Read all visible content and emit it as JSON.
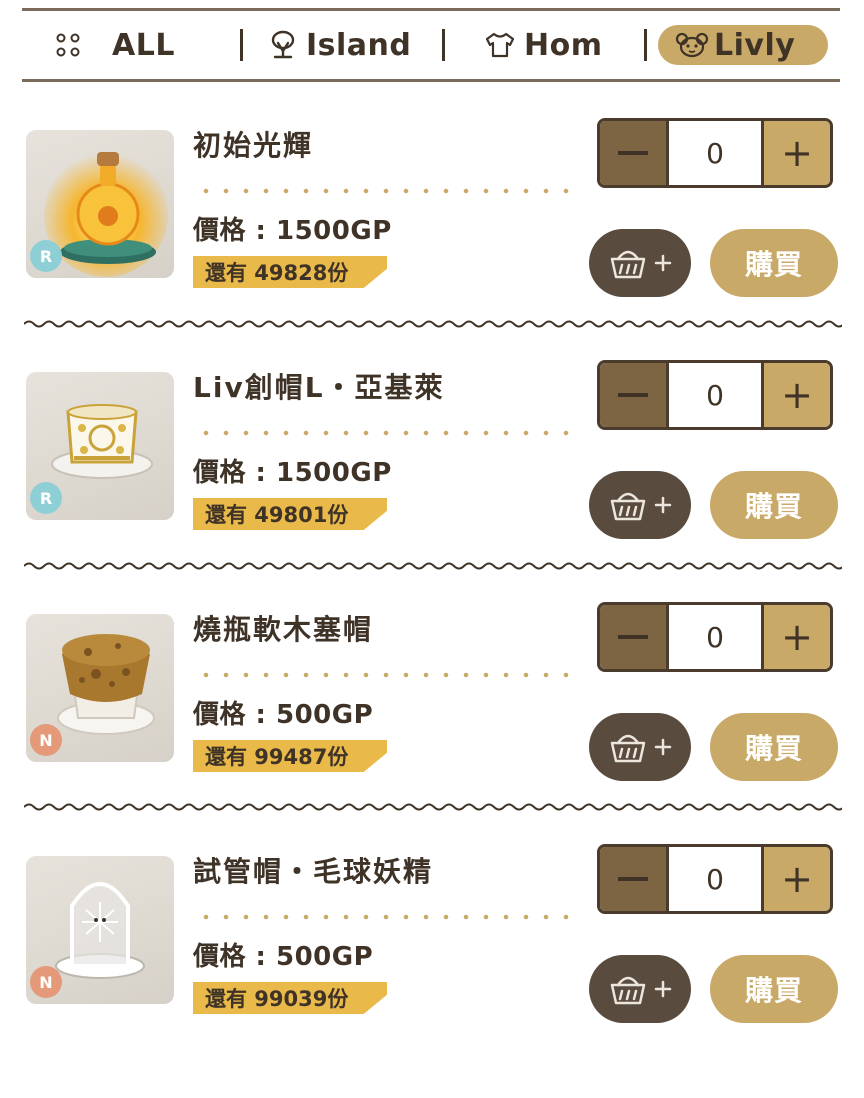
{
  "tabs": [
    {
      "label": "ALL",
      "icon": "grid-dots-icon",
      "active": false
    },
    {
      "label": "Island",
      "icon": "tree-icon",
      "active": false
    },
    {
      "label": "Hom",
      "icon": "shirt-icon",
      "active": false
    },
    {
      "label": "Livly",
      "icon": "creature-face-icon",
      "active": true
    }
  ],
  "colors": {
    "accent_gold": "#c9a968",
    "dark_brown": "#4a3b2c",
    "stock_yellow": "#e9b94a",
    "rarity_r": "#8ecfd6",
    "rarity_n": "#e49a78",
    "cart_button": "#5a4b3f",
    "minus_button": "#7d6443"
  },
  "items": [
    {
      "name": "初始光輝",
      "price": "價格 : 1500GP",
      "stock": "還有 49828份",
      "rarity": "R",
      "quantity": "0",
      "buy_label": "購買",
      "icon": "glowing-bottle-icon"
    },
    {
      "name": "Liv創帽L・亞基萊",
      "price": "價格 : 1500GP",
      "stock": "還有 49801份",
      "rarity": "R",
      "quantity": "0",
      "buy_label": "購買",
      "icon": "ornate-top-hat-icon"
    },
    {
      "name": "燒瓶軟木塞帽",
      "price": "價格 : 500GP",
      "stock": "還有 99487份",
      "rarity": "N",
      "quantity": "0",
      "buy_label": "購買",
      "icon": "cork-hat-icon"
    },
    {
      "name": "試管帽・毛球妖精",
      "price": "價格 : 500GP",
      "stock": "還有 99039份",
      "rarity": "N",
      "quantity": "0",
      "buy_label": "購買",
      "icon": "glass-dome-hat-icon"
    }
  ]
}
